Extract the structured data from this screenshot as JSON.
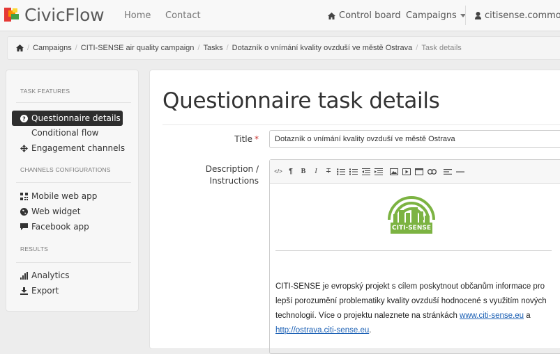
{
  "app": {
    "name": "CivicFlow"
  },
  "nav": {
    "home": "Home",
    "contact": "Contact",
    "control_board": "Control board",
    "campaigns": "Campaigns",
    "user": "citisense.common"
  },
  "breadcrumb": [
    "Campaigns",
    "CITI-SENSE air quality campaign",
    "Tasks",
    "Dotazník o vnímání kvality ovzduší ve městě Ostrava",
    "Task details"
  ],
  "sidebar": {
    "task_features_head": "TASK FEATURES",
    "questionnaire_details": "Questionnaire details",
    "conditional_flow": "Conditional flow",
    "engagement_channels": "Engagement channels",
    "channels_head": "CHANNELS CONFIGURATIONS",
    "mobile_web_app": "Mobile web app",
    "web_widget": "Web widget",
    "facebook_app": "Facebook app",
    "results_head": "RESULTS",
    "analytics": "Analytics",
    "export": "Export"
  },
  "main": {
    "title": "Questionnaire task details",
    "title_label": "Title",
    "title_value": "Dotazník o vnímání kvality ovzduší ve městě Ostrava",
    "desc_label_1": "Description /",
    "desc_label_2": "Instructions",
    "toolbar": {
      "code": "</>",
      "paragraph": "¶",
      "bold": "B",
      "italic": "I",
      "strike": "T"
    },
    "logo_text": "CITI-SENSE",
    "para_1": "CITI-SENSE je evropský projekt s cílem poskytnout občanům informace pro lepší porozumění problematiky kvality ovzduší hodnocené s využitím nových technologií. Více o projektu naleznete na stránkách ",
    "link_1": "www.citi-sense.eu",
    "para_and": " a ",
    "link_2": "http://ostrava.citi-sense.eu",
    "para_end": "."
  },
  "colors": {
    "accent_green": "#7cb342",
    "logo_red": "#e53935",
    "logo_orange": "#fb8c00",
    "logo_green": "#43a047",
    "logo_yellow": "#fdd835",
    "link": "#1a5fb4"
  }
}
